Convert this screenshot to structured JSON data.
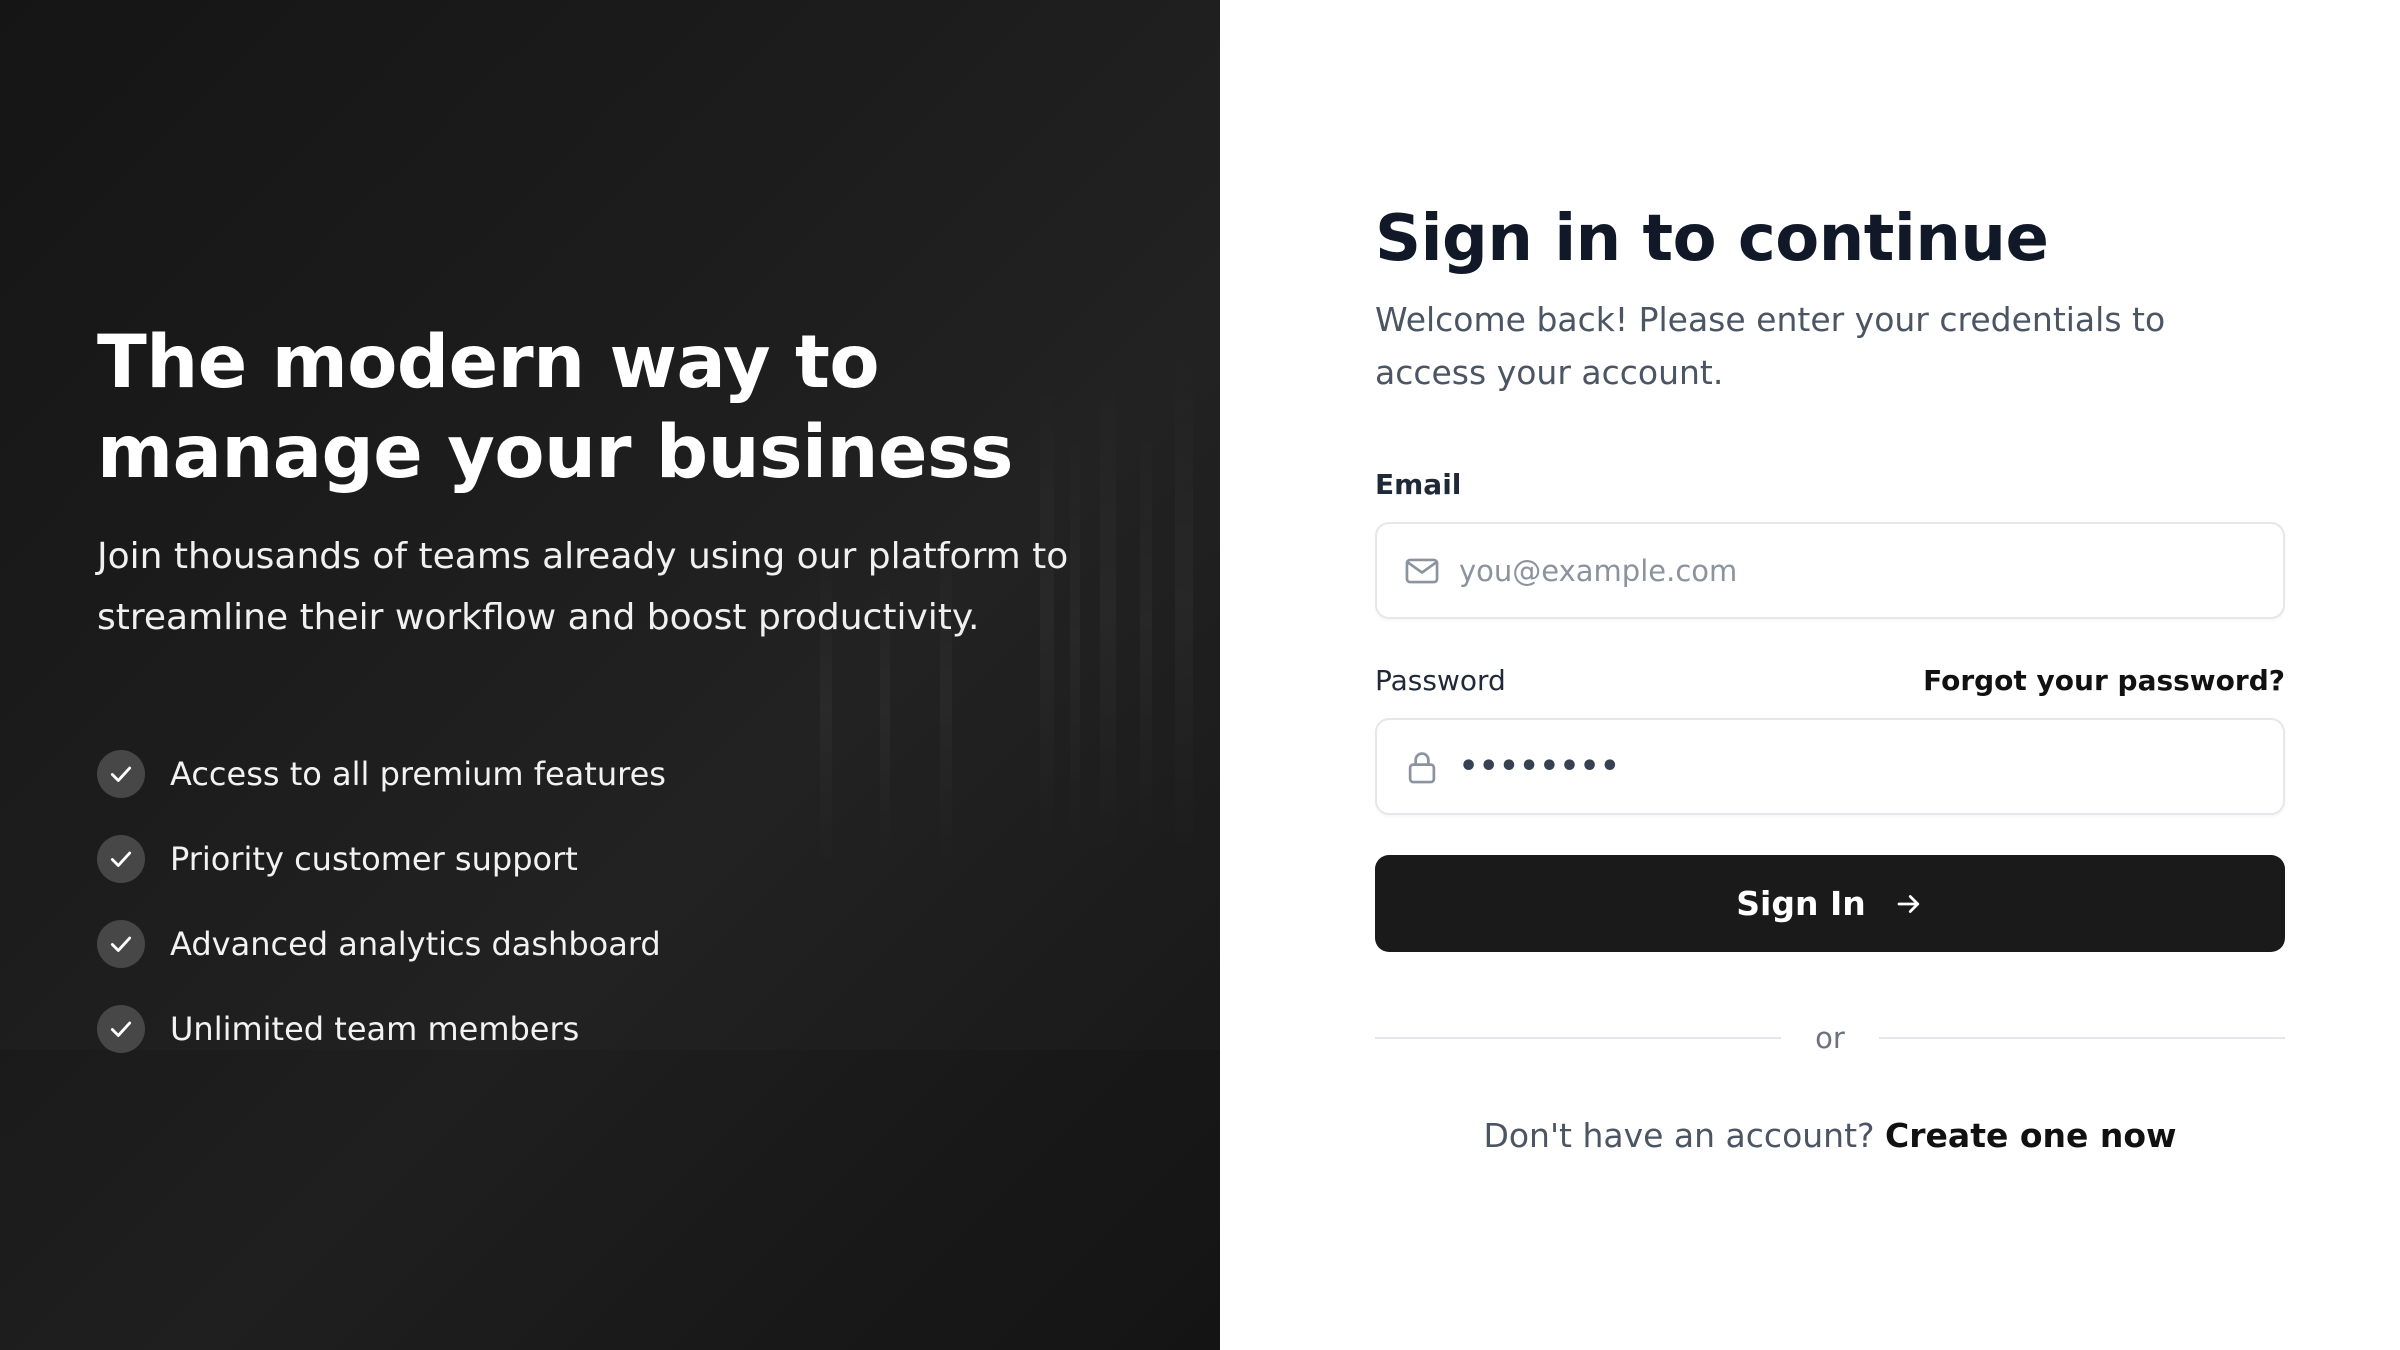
{
  "hero": {
    "title": "The modern way to manage your business",
    "subtitle": "Join thousands of teams already using our platform to streamline their workflow and boost productivity.",
    "features": [
      {
        "label": "Access to all premium features",
        "icon": "check-icon"
      },
      {
        "label": "Priority customer support",
        "icon": "check-icon"
      },
      {
        "label": "Advanced analytics dashboard",
        "icon": "check-icon"
      },
      {
        "label": "Unlimited team members",
        "icon": "check-icon"
      }
    ]
  },
  "form": {
    "title": "Sign in to continue",
    "subtitle": "Welcome back! Please enter your credentials to access your account.",
    "email": {
      "label": "Email",
      "placeholder": "you@example.com",
      "value": "",
      "icon": "mail-icon"
    },
    "password": {
      "label": "Password",
      "masked_value": "••••••••",
      "icon": "lock-icon",
      "forgot_label": "Forgot your password?"
    },
    "submit": {
      "label": "Sign In",
      "icon": "arrow-right-icon"
    },
    "divider_text": "or",
    "signup": {
      "prompt": "Don't have an account?",
      "link_label": "Create one now"
    }
  },
  "colors": {
    "hero_background": "#1b1b1b",
    "button_background": "#1a1a1a",
    "check_badge": "#474747",
    "heading_text": "#111827",
    "muted_text": "#4b5563",
    "input_border": "#e5e7eb"
  }
}
